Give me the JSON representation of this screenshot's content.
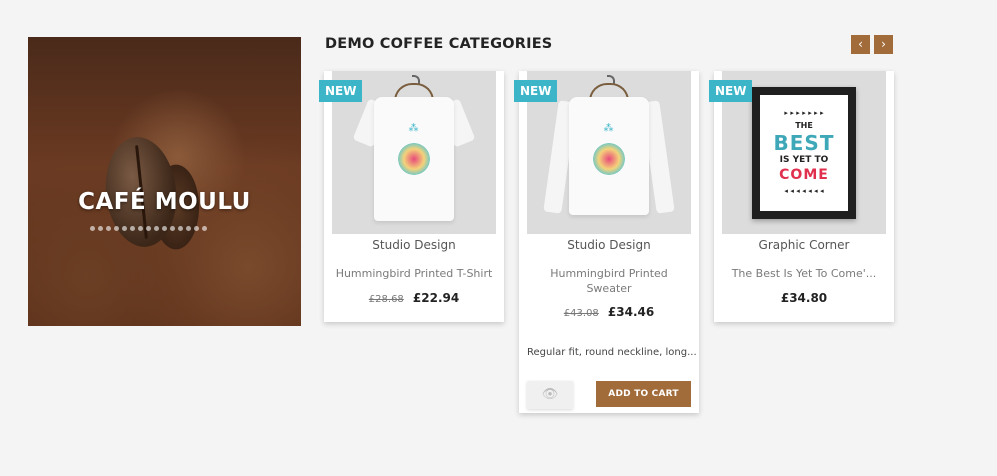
{
  "banner": {
    "title": "CAFÉ MOULU",
    "dots": 15
  },
  "section": {
    "title": "DEMO COFFEE CATEGORIES",
    "prev_icon": "chevron-left-icon",
    "next_icon": "chevron-right-icon",
    "prev_glyph": "‹",
    "next_glyph": "›"
  },
  "products": [
    {
      "badge": "NEW",
      "brand": "Studio Design",
      "name": "Hummingbird Printed T-Shirt",
      "old_price": "£28.68",
      "price": "£22.94"
    },
    {
      "badge": "NEW",
      "brand": "Studio Design",
      "name": "Hummingbird Printed Sweater",
      "old_price": "£43.08",
      "price": "£34.46",
      "description": "Regular fit, round neckline, long...",
      "quick_view_icon": "eye-icon",
      "eye_glyph": "👁",
      "add_to_cart": "ADD TO CART"
    },
    {
      "badge": "NEW",
      "brand": "Graphic Corner",
      "name": "The Best Is Yet To Come'...",
      "price": "£34.80",
      "poster": {
        "line1": "THE",
        "line2": "BEST",
        "line3": "IS YET TO",
        "line4": "COME",
        "arrows": "▸ ▸ ▸ ▸ ▸ ▸ ▸",
        "arrows2": "◂ ◂ ◂ ◂ ◂ ◂ ◂"
      }
    }
  ],
  "colors": {
    "accent": "#a26b3a",
    "badge": "#3cb5c8",
    "background": "#f4f4f4"
  }
}
